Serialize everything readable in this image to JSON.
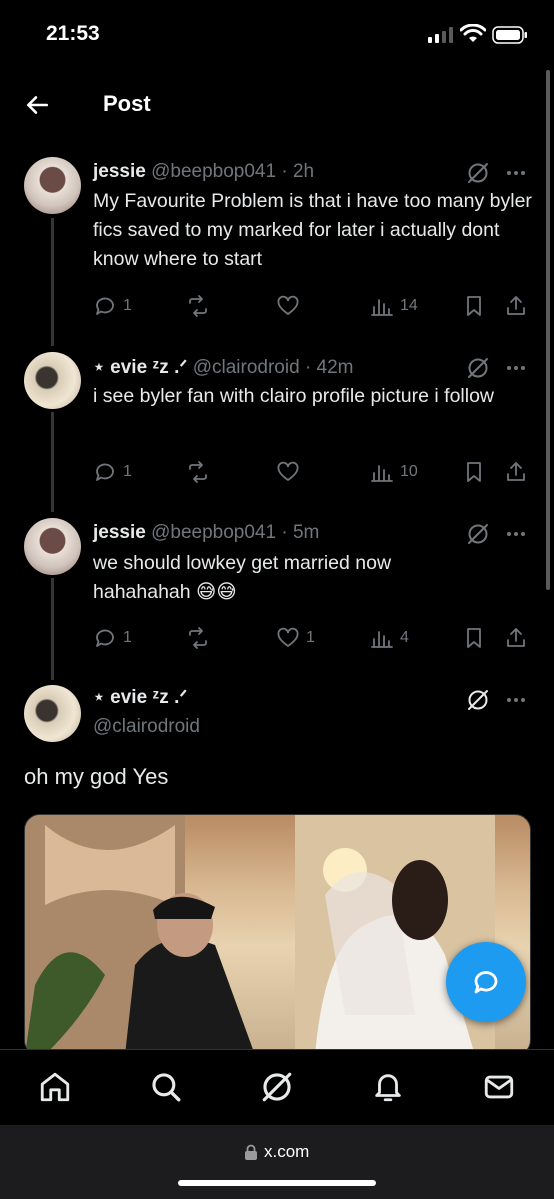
{
  "status_bar": {
    "time": "21:53"
  },
  "header": {
    "title": "Post"
  },
  "tweets": [
    {
      "name": "jessie",
      "meta": "@beepbop041 · 2h",
      "text": "My Favourite Problem is that i have too many byler fics saved to my marked for later i actually dont know where to start",
      "replies": "1",
      "retweets": "",
      "likes": "",
      "views": "14"
    },
    {
      "name": "⋆ evie ᶻz .ᐟ",
      "meta": "@clairodroid · 42m",
      "text": "i see byler fan with clairo profile picture i follow",
      "replies": "1",
      "retweets": "",
      "likes": "",
      "views": "10"
    },
    {
      "name": "jessie",
      "meta": "@beepbop041 · 5m",
      "text": "we should lowkey get married now hahahahah 😅😅",
      "replies": "1",
      "retweets": "",
      "likes": "1",
      "views": "4"
    }
  ],
  "main_post": {
    "name": "⋆ evie ᶻz .ᐟ",
    "handle": "@clairodroid",
    "text": "oh my god Yes"
  },
  "browser": {
    "url": "x.com"
  },
  "icons": {
    "back": "arrow-left-icon",
    "grok": "grok-icon",
    "more": "more-icon",
    "reply": "reply-icon",
    "retweet": "retweet-icon",
    "like": "heart-icon",
    "views": "views-icon",
    "bookmark": "bookmark-icon",
    "share": "share-icon",
    "compose": "compose-reply-icon",
    "tabs": [
      "home-icon",
      "search-icon",
      "grok-icon",
      "notifications-icon",
      "messages-icon"
    ]
  },
  "colors": {
    "accent": "#1d9bf0",
    "background": "#000000",
    "muted": "#71767b",
    "text": "#e7e9ea"
  }
}
